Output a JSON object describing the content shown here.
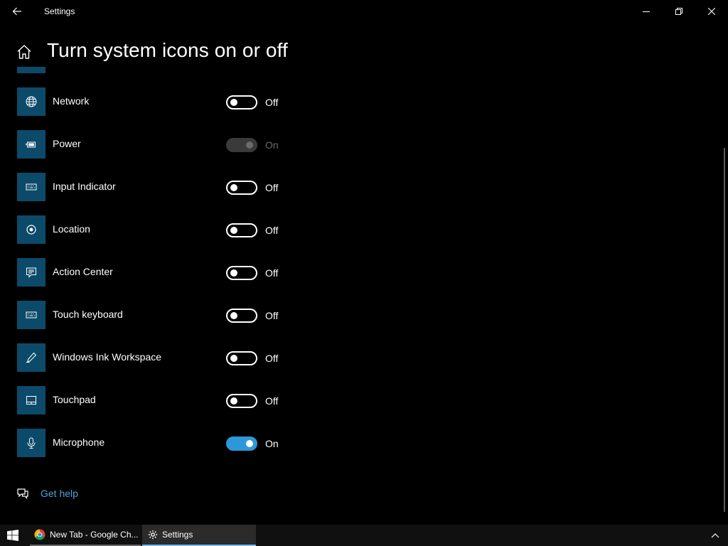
{
  "window": {
    "title": "Settings",
    "controls": {
      "minimize": "minimize",
      "maximize": "restore",
      "close": "close"
    }
  },
  "page": {
    "title": "Turn system icons on or off"
  },
  "items": [
    {
      "label": "Network",
      "icon": "globe-icon",
      "state": "Off",
      "on": false,
      "disabled": false
    },
    {
      "label": "Power",
      "icon": "battery-icon",
      "state": "On",
      "on": true,
      "disabled": true
    },
    {
      "label": "Input Indicator",
      "icon": "keyboard-icon",
      "state": "Off",
      "on": false,
      "disabled": false
    },
    {
      "label": "Location",
      "icon": "location-icon",
      "state": "Off",
      "on": false,
      "disabled": false
    },
    {
      "label": "Action Center",
      "icon": "action-center-icon",
      "state": "Off",
      "on": false,
      "disabled": false
    },
    {
      "label": "Touch keyboard",
      "icon": "touch-keyboard-icon",
      "state": "Off",
      "on": false,
      "disabled": false
    },
    {
      "label": "Windows Ink Workspace",
      "icon": "pen-icon",
      "state": "Off",
      "on": false,
      "disabled": false
    },
    {
      "label": "Touchpad",
      "icon": "touchpad-icon",
      "state": "Off",
      "on": false,
      "disabled": false
    },
    {
      "label": "Microphone",
      "icon": "microphone-icon",
      "state": "On",
      "on": true,
      "disabled": false
    }
  ],
  "help": {
    "label": "Get help"
  },
  "taskbar": {
    "apps": [
      {
        "label": "New Tab - Google Ch...",
        "icon": "chrome-icon",
        "active": false
      },
      {
        "label": "Settings",
        "icon": "gear-icon",
        "active": true
      }
    ]
  },
  "colors": {
    "accent": "#2d97d8",
    "tile": "#0c4a6a",
    "link": "#4ea3d8",
    "background": "#000000"
  }
}
